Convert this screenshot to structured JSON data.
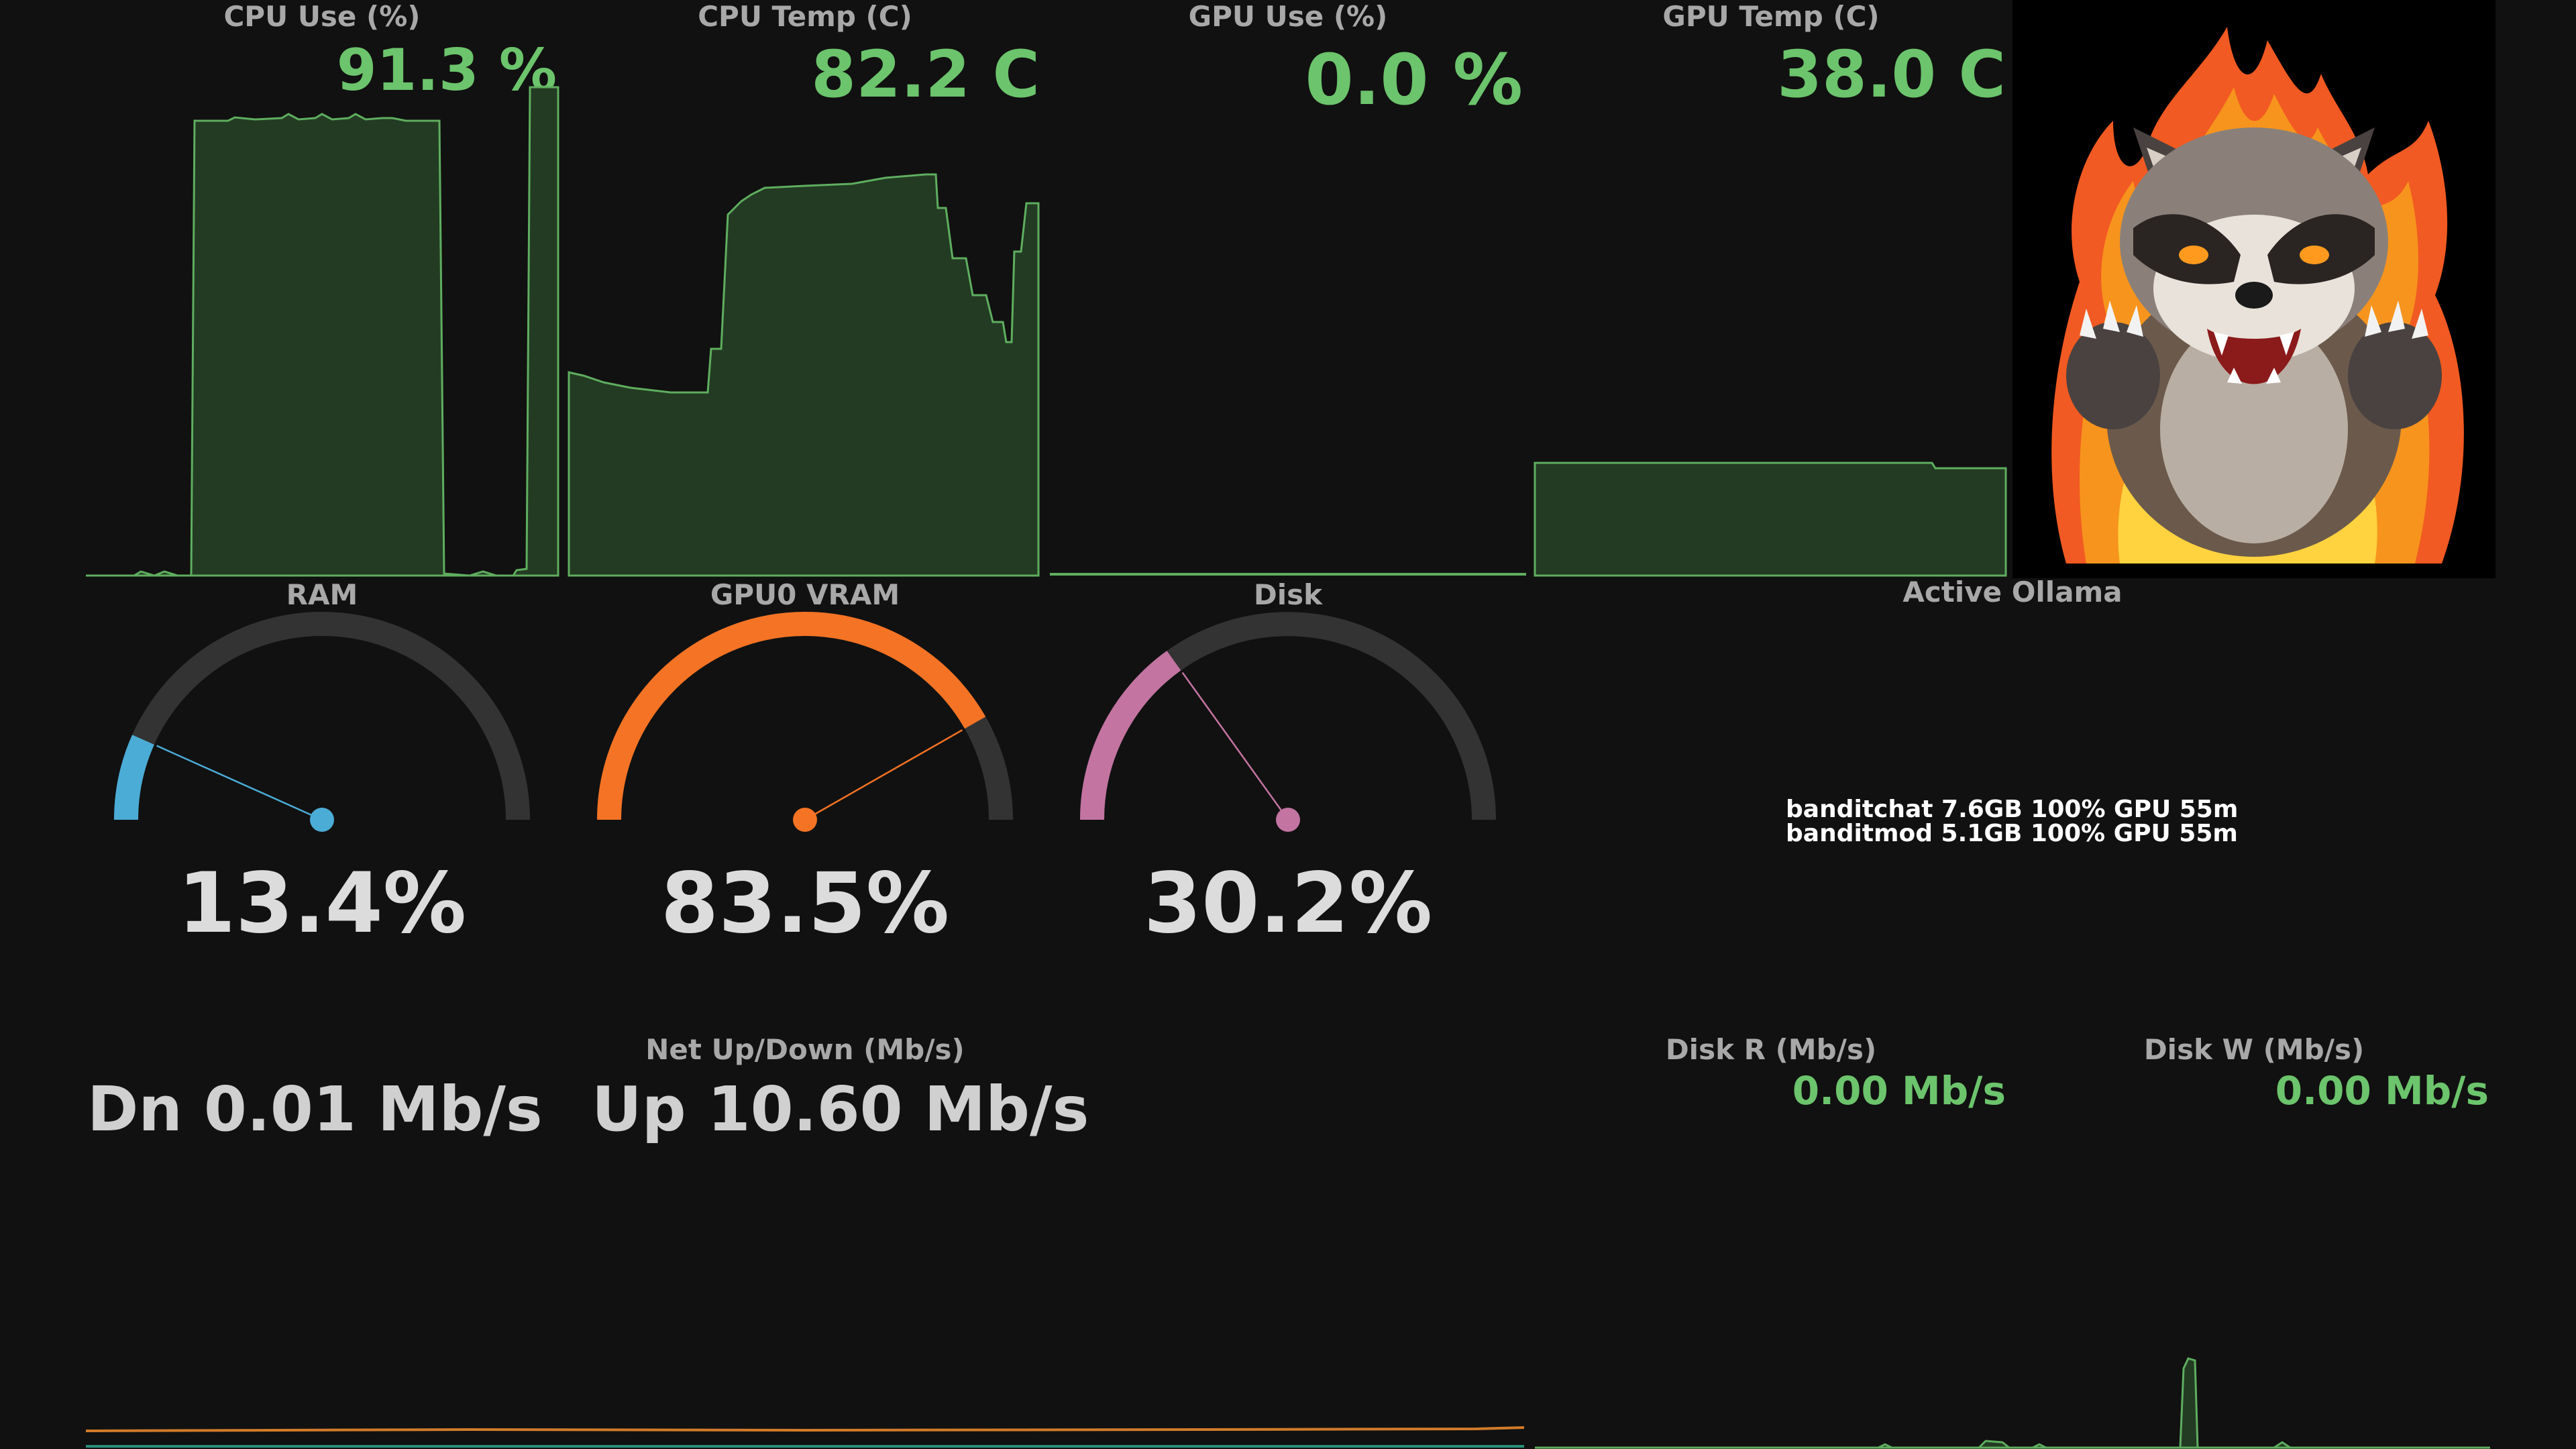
{
  "metrics": {
    "cpu_use": {
      "title": "CPU Use (%)",
      "value": "91.3 %"
    },
    "cpu_temp": {
      "title": "CPU Temp (C)",
      "value": "82.2 C"
    },
    "gpu_use": {
      "title": "GPU Use (%)",
      "value": "0.0 %"
    },
    "gpu_temp": {
      "title": "GPU Temp (C)",
      "value": "38.0 C"
    }
  },
  "gauges": {
    "ram": {
      "title": "RAM",
      "value": "13.4%",
      "fraction": 0.134,
      "color": "#4bacd6"
    },
    "vram": {
      "title": "GPU0 VRAM",
      "value": "83.5%",
      "fraction": 0.835,
      "color": "#f47324"
    },
    "disk": {
      "title": "Disk",
      "value": "30.2%",
      "fraction": 0.302,
      "color": "#c374a1"
    }
  },
  "ollama": {
    "title": "Active Ollama",
    "lines": [
      "banditchat 7.6GB 100% GPU 55m",
      "banditmod 5.1GB 100% GPU 55m"
    ]
  },
  "network": {
    "title": "Net Up/Down (Mb/s)",
    "down": "Dn 0.01 Mb/s",
    "up": "Up 10.60 Mb/s"
  },
  "disk_io": {
    "read": {
      "title": "Disk R (Mb/s)",
      "value": "0.00 Mb/s"
    },
    "write": {
      "title": "Disk W (Mb/s)",
      "value": "0.00 Mb/s"
    }
  },
  "mascot": {
    "icon": "raccoon-on-fire-icon"
  },
  "colors": {
    "background": "#111111",
    "chart_fill": "#233b23",
    "chart_line": "#5fae5f",
    "value_green": "#6cc46c",
    "gauge_track": "#333333",
    "net_down": "#2a8f7a",
    "net_up": "#d27b2a"
  }
}
